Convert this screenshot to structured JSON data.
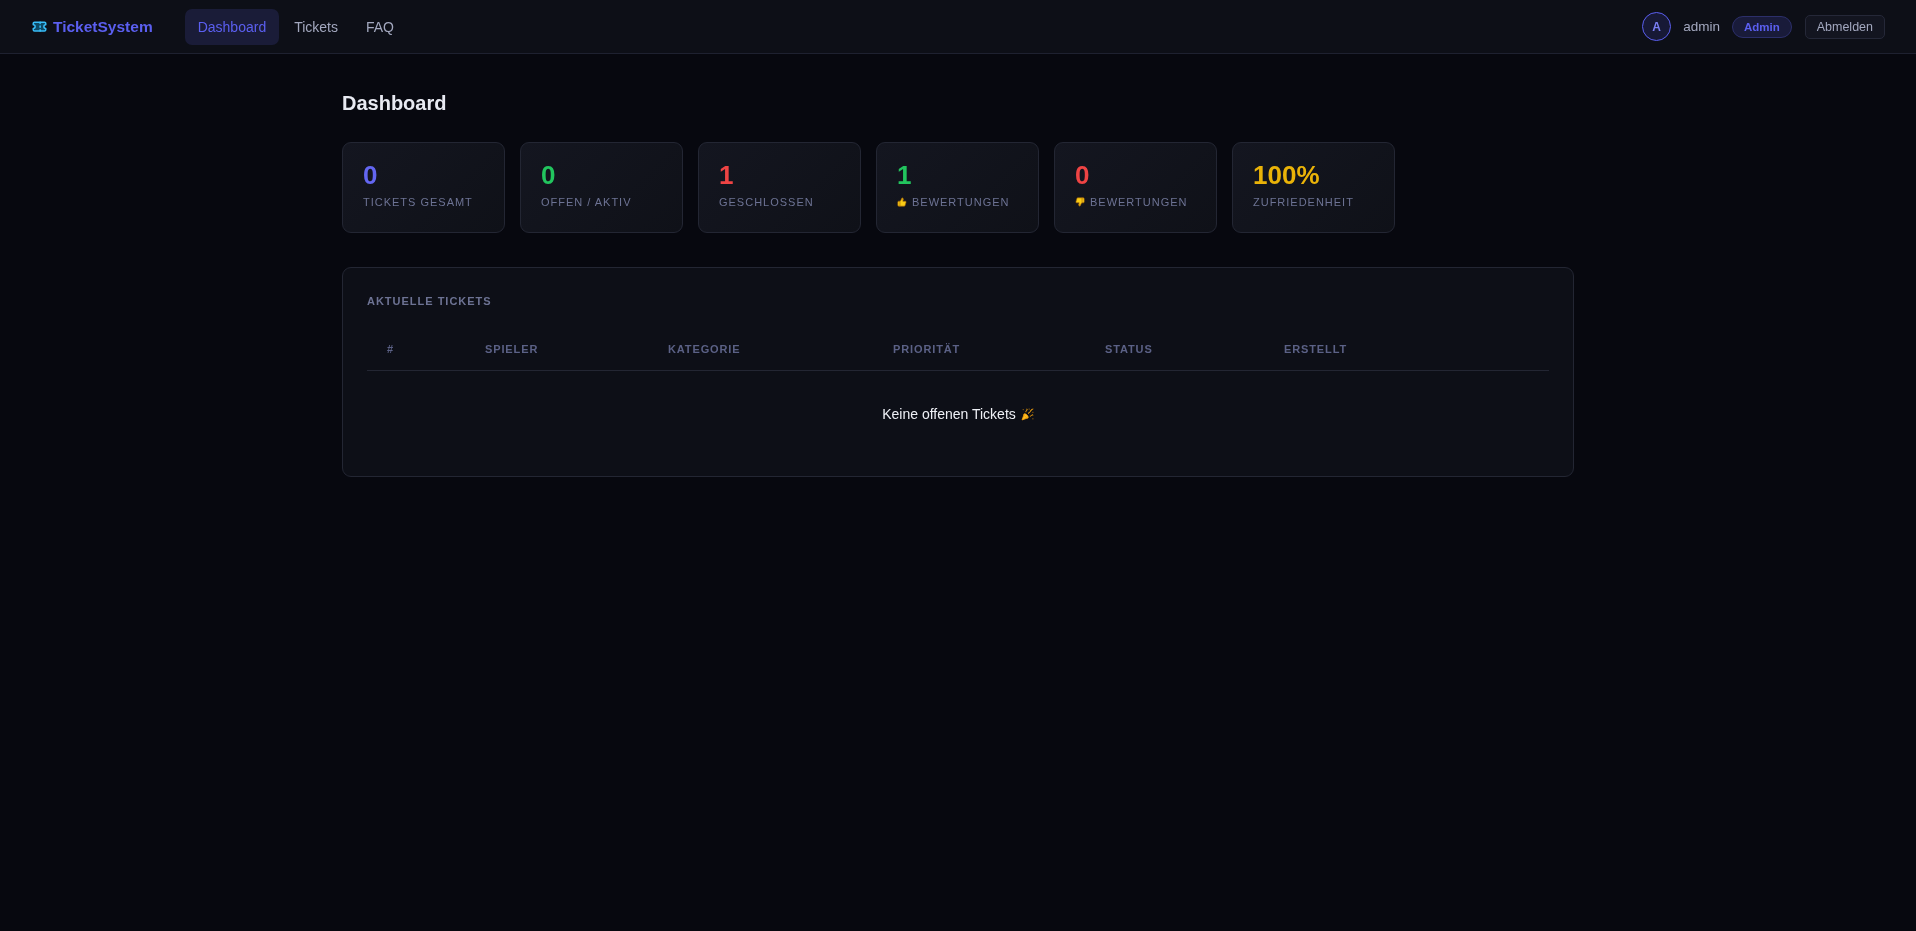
{
  "nav": {
    "brand": "TicketSystem",
    "tabs": [
      {
        "label": "Dashboard",
        "selected": true
      },
      {
        "label": "Tickets",
        "selected": false
      },
      {
        "label": "FAQ",
        "selected": false
      }
    ],
    "user": {
      "avatar_letter": "A",
      "name": "admin",
      "role": "Admin"
    },
    "logout": "Abmelden"
  },
  "page": {
    "title": "Dashboard"
  },
  "stats": [
    {
      "kind": "plain",
      "value": "0",
      "label": "TICKETS GESAMT",
      "color": "#6366f1"
    },
    {
      "kind": "plain",
      "value": "0",
      "label": "OFFEN / AKTIV",
      "color": "#22c55e"
    },
    {
      "kind": "plain",
      "value": "1",
      "label": "GESCHLOSSEN",
      "color": "#ef4444"
    },
    {
      "kind": "upvote",
      "value": "1",
      "label": "BEWERTUNGEN",
      "color": "#22c55e"
    },
    {
      "kind": "downvote",
      "value": "0",
      "label": "BEWERTUNGEN",
      "color": "#ef4444"
    },
    {
      "kind": "plain",
      "value": "100%",
      "label": "ZUFRIEDENHEIT",
      "color": "#eab308"
    }
  ],
  "recent_tickets": {
    "title": "AKTUELLE TICKETS",
    "columns": [
      "#",
      "SPIELER",
      "KATEGORIE",
      "PRIORITÄT",
      "STATUS",
      "ERSTELLT"
    ],
    "empty_message": "Keine offenen Tickets"
  }
}
